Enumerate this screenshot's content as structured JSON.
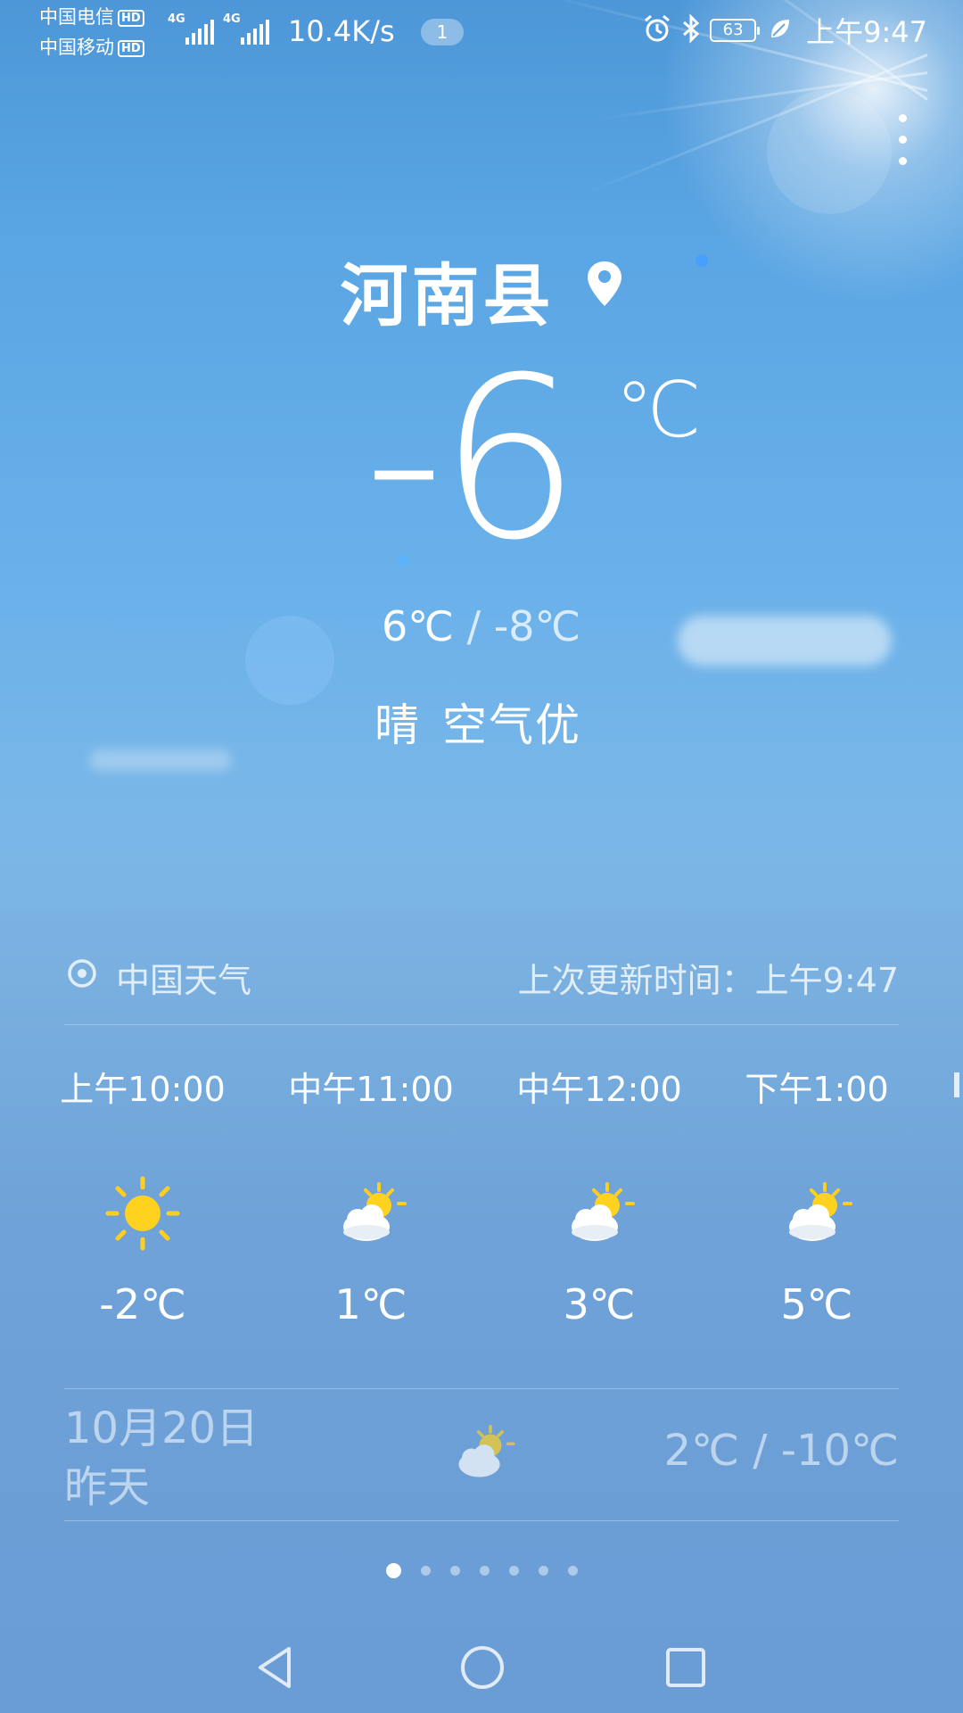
{
  "status_bar": {
    "carrier_1": "中国电信",
    "carrier_2": "中国移动",
    "hd_1": "HD",
    "hd_2": "HD",
    "network_1": "4G",
    "network_2": "4G",
    "net_speed": "10.4K/s",
    "notification_count": "1",
    "battery": "63",
    "time": "上午9:47",
    "icons": [
      "alarm-icon",
      "bluetooth-icon",
      "battery-icon",
      "eco-leaf-icon"
    ]
  },
  "weather": {
    "city": "河南县",
    "current_temp": "-6",
    "unit": "℃",
    "high": "6℃",
    "separator": "/",
    "low": "-8℃",
    "condition": "晴",
    "air_quality": "空气优"
  },
  "source": {
    "name": "中国天气",
    "updated": "上次更新时间：上午9:47"
  },
  "hourly": [
    {
      "time": "上午10:00",
      "icon": "sunny-icon",
      "temp": "-2℃"
    },
    {
      "time": "中午11:00",
      "icon": "partly-cloudy-icon",
      "temp": "1℃"
    },
    {
      "time": "中午12:00",
      "icon": "partly-cloudy-icon",
      "temp": "3℃"
    },
    {
      "time": "下午1:00",
      "icon": "partly-cloudy-icon",
      "temp": "5℃"
    }
  ],
  "yesterday": {
    "date": "10月20日",
    "label": "昨天",
    "icon": "partly-cloudy-icon",
    "range": "2℃ / -10℃"
  },
  "pager": {
    "total": 7,
    "active": 0
  },
  "colors": {
    "sky_top": "#4d97d8",
    "sky_bottom": "#6a9cd5",
    "sun_yellow": "#ffd21f"
  }
}
